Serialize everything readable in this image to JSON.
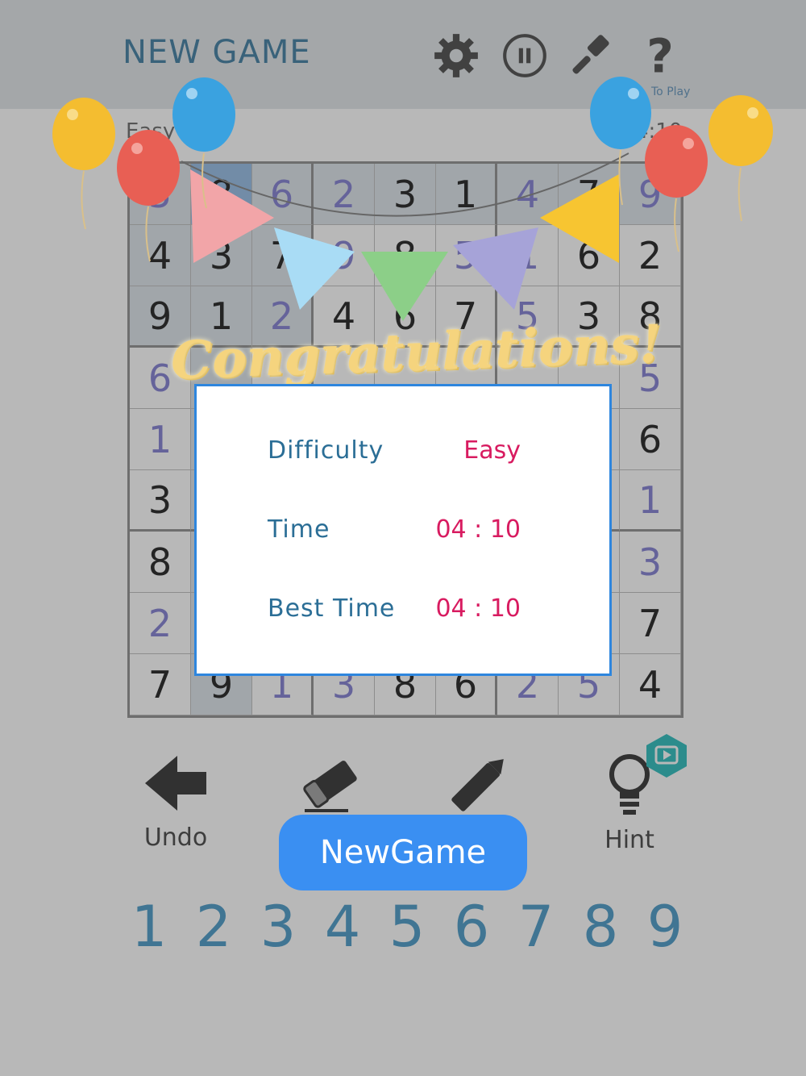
{
  "header": {
    "title": "NEW GAME",
    "howto_label": "To Play",
    "difficulty": "Easy",
    "timer": "4:10"
  },
  "grid": {
    "rows": [
      [
        "5",
        "8",
        "6",
        "2",
        "3",
        "1",
        "4",
        "7",
        "9"
      ],
      [
        "4",
        "3",
        "7",
        "9",
        "8",
        "5",
        "1",
        "6",
        "2"
      ],
      [
        "9",
        "1",
        "2",
        "4",
        "6",
        "7",
        "5",
        "3",
        "8"
      ],
      [
        "6",
        "",
        "",
        "",
        "",
        "",
        "",
        "",
        "5"
      ],
      [
        "1",
        "",
        "",
        "",
        "",
        "",
        "",
        "",
        "6"
      ],
      [
        "3",
        "",
        "",
        "",
        "",
        "",
        "",
        "",
        "1"
      ],
      [
        "8",
        "",
        "",
        "",
        "",
        "",
        "",
        "",
        "3"
      ],
      [
        "2",
        "",
        "",
        "",
        "",
        "",
        "",
        "",
        "7"
      ],
      [
        "7",
        "9",
        "1",
        "3",
        "8",
        "6",
        "2",
        "5",
        "4"
      ]
    ]
  },
  "tools": {
    "undo_label": "Undo",
    "hint_label": "Hint"
  },
  "numpad": [
    "1",
    "2",
    "3",
    "4",
    "5",
    "6",
    "7",
    "8",
    "9"
  ],
  "dialog": {
    "heading": "Congratulations!",
    "rows": [
      {
        "label": "Difficulty",
        "value": "Easy"
      },
      {
        "label": "Time",
        "value": "04 : 10"
      },
      {
        "label": "Best Time",
        "value": "04 : 10"
      }
    ],
    "button_label": "NewGame"
  },
  "colors": {
    "accent": "#2e86de",
    "value_text": "#d81b60",
    "label_text": "#2b6e96"
  }
}
